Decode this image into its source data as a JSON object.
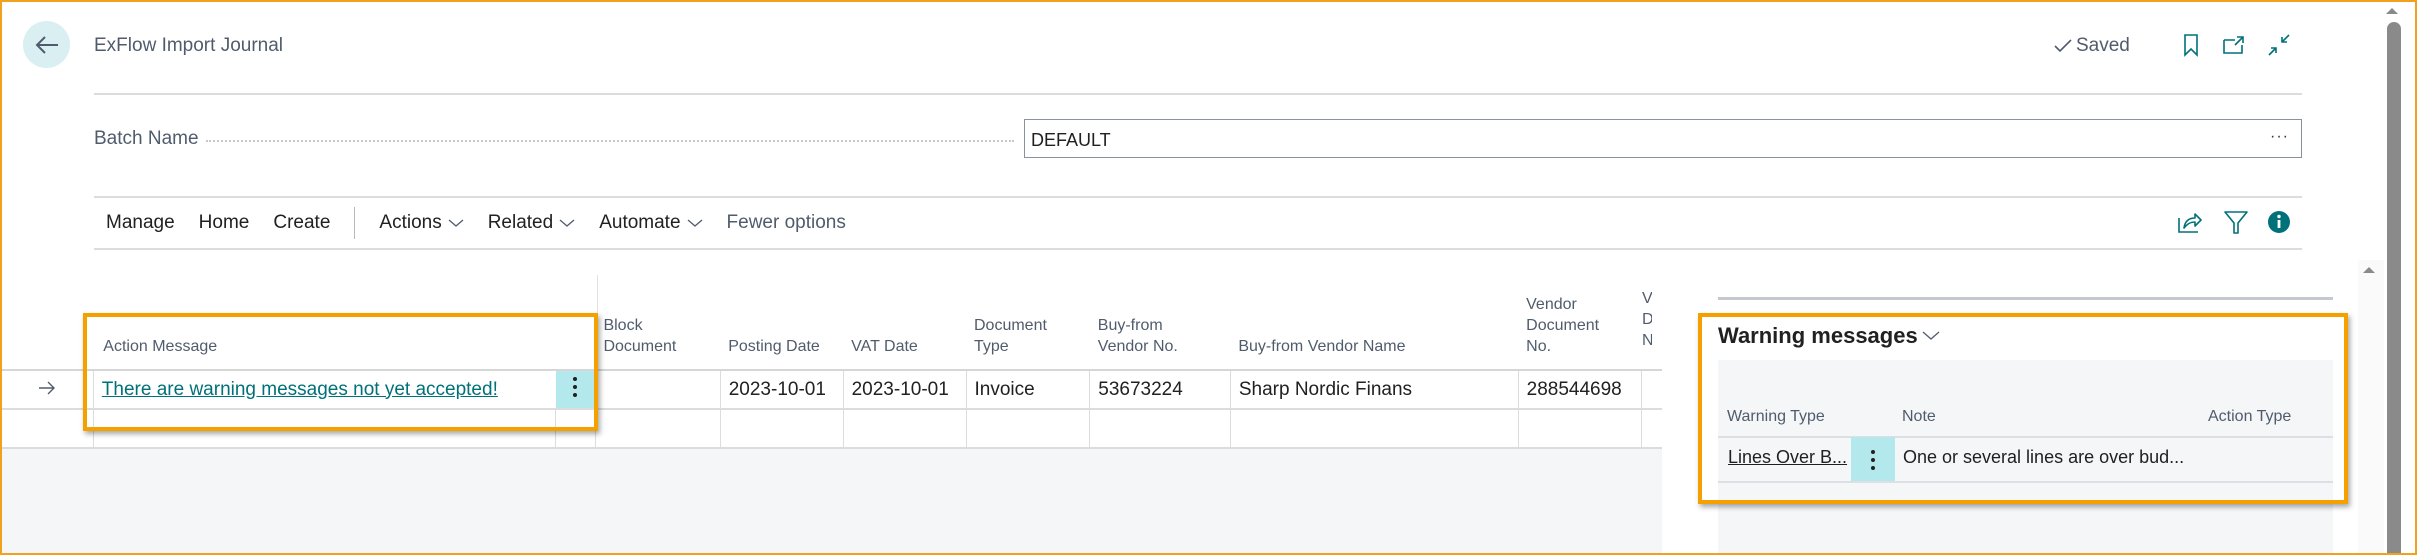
{
  "header": {
    "title": "ExFlow Import Journal",
    "saved_status": "Saved",
    "icons": [
      "back-arrow-icon",
      "bookmark-icon",
      "open-new-window-icon",
      "collapse-icon"
    ]
  },
  "batch": {
    "label": "Batch Name",
    "value": "DEFAULT",
    "lookup": "···"
  },
  "actionbar": {
    "items": [
      {
        "label": "Manage",
        "dropdown": false
      },
      {
        "label": "Home",
        "dropdown": false
      },
      {
        "label": "Create",
        "dropdown": false
      },
      {
        "label": "Actions",
        "dropdown": true
      },
      {
        "label": "Related",
        "dropdown": true
      },
      {
        "label": "Automate",
        "dropdown": true
      },
      {
        "label": "Fewer options",
        "dropdown": false
      }
    ],
    "right_icons": [
      "share-icon",
      "filter-icon",
      "info-icon"
    ]
  },
  "grid": {
    "columns": [
      "Action Message",
      "Block Document",
      "Posting Date",
      "VAT Date",
      "Document Type",
      "Buy-from Vendor No.",
      "Buy-from Vendor Name",
      "Vendor Document No.",
      "V D N"
    ],
    "rows": [
      {
        "action_message": "There are warning messages not yet accepted!",
        "block_document": "",
        "posting_date": "2023-10-01",
        "vat_date": "2023-10-01",
        "document_type": "Invoice",
        "vendor_no": "53673224",
        "vendor_name": "Sharp Nordic Finans",
        "vendor_doc_no": "288544698"
      }
    ]
  },
  "factbox": {
    "title": "Warning messages",
    "columns": [
      "Warning Type",
      "Note",
      "Action Type"
    ],
    "rows": [
      {
        "warning_type": "Lines Over B...",
        "note": "One or several lines are over bud...",
        "action_type": ""
      }
    ]
  },
  "colors": {
    "accent": "#00717a",
    "highlight": "#f4a100",
    "selected_cell": "#b3e8ec",
    "back_button_bg": "#d9eff2"
  }
}
